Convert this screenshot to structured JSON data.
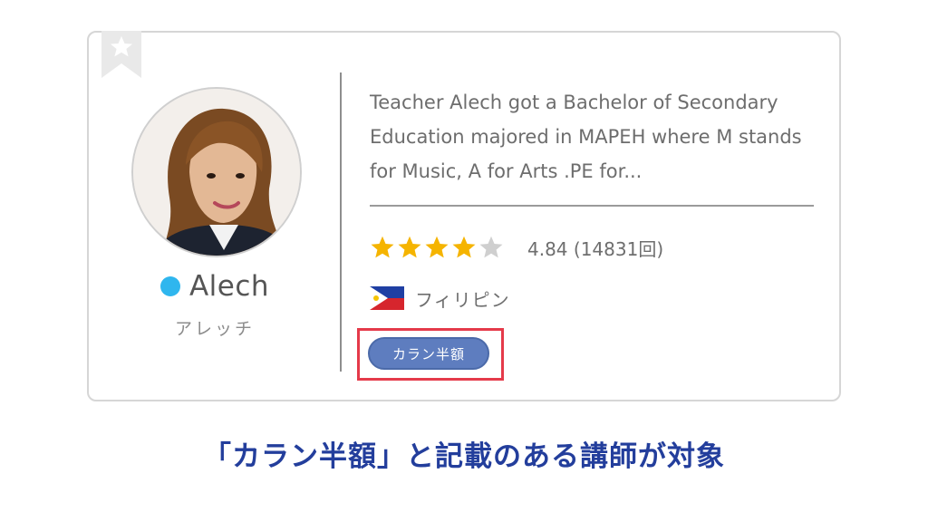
{
  "teacher": {
    "name": "Alech",
    "name_kana": "アレッチ",
    "online_status_color": "#2fb6ee",
    "description": "Teacher Alech got a Bachelor of Secondary Education majored in MAPEH where M stands for Music, A for Arts .PE for...",
    "rating": 4.84,
    "rating_text": "4.84 (14831回)",
    "stars_filled": 4,
    "stars_total": 5,
    "country": "フィリピン",
    "badge_label": "カラン半額",
    "badge_color": "#5e7dbf"
  },
  "icons": {
    "bookmark": "bookmark-star-icon",
    "star": "star-icon",
    "flag": "philippines-flag-icon"
  },
  "colors": {
    "highlight_border": "#e53a4a",
    "caption": "#233e9c",
    "star_filled": "#f5b400",
    "star_empty": "#cfcfcf"
  },
  "caption": "「カラン半額」と記載のある講師が対象"
}
